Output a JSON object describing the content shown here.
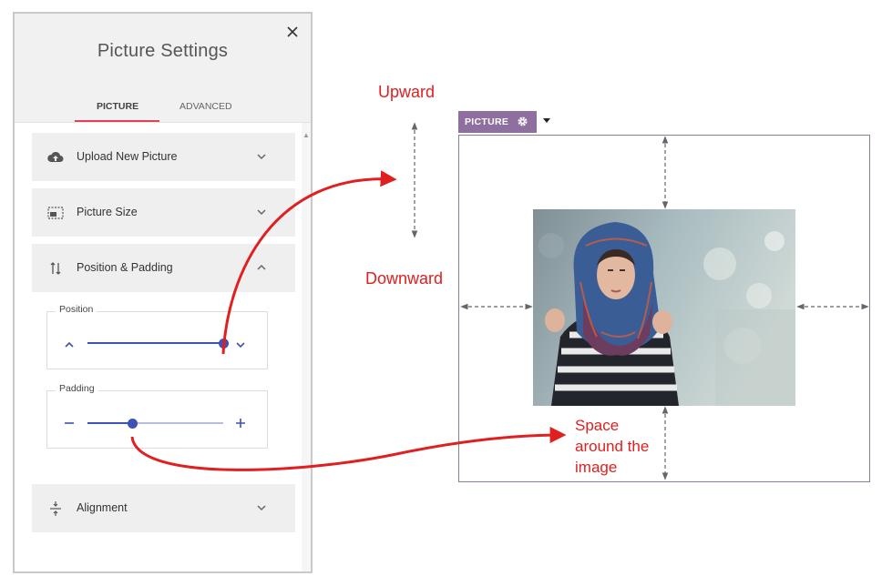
{
  "panel": {
    "title": "Picture Settings",
    "tabs": [
      {
        "label": "PICTURE",
        "active": true
      },
      {
        "label": "ADVANCED",
        "active": false
      }
    ],
    "accent_color": "#e2415a",
    "sections": [
      {
        "label": "Upload New Picture",
        "icon": "cloud-upload-icon",
        "expanded": false
      },
      {
        "label": "Picture Size",
        "icon": "picture-size-icon",
        "expanded": false
      },
      {
        "label": "Position & Padding",
        "icon": "position-arrows-icon",
        "expanded": true
      },
      {
        "label": "Alignment",
        "icon": "vertical-align-icon",
        "expanded": false
      }
    ],
    "position": {
      "label": "Position",
      "value": 1.0
    },
    "padding": {
      "label": "Padding",
      "value": 0.33
    },
    "slider_color": "#3e51b5"
  },
  "preview": {
    "badge_label": "PICTURE",
    "badge_color": "#8e6fa0"
  },
  "annotations": {
    "upward": "Upward",
    "downward": "Downward",
    "space": [
      "Space",
      "around the",
      "image"
    ],
    "color": "#e02020"
  }
}
